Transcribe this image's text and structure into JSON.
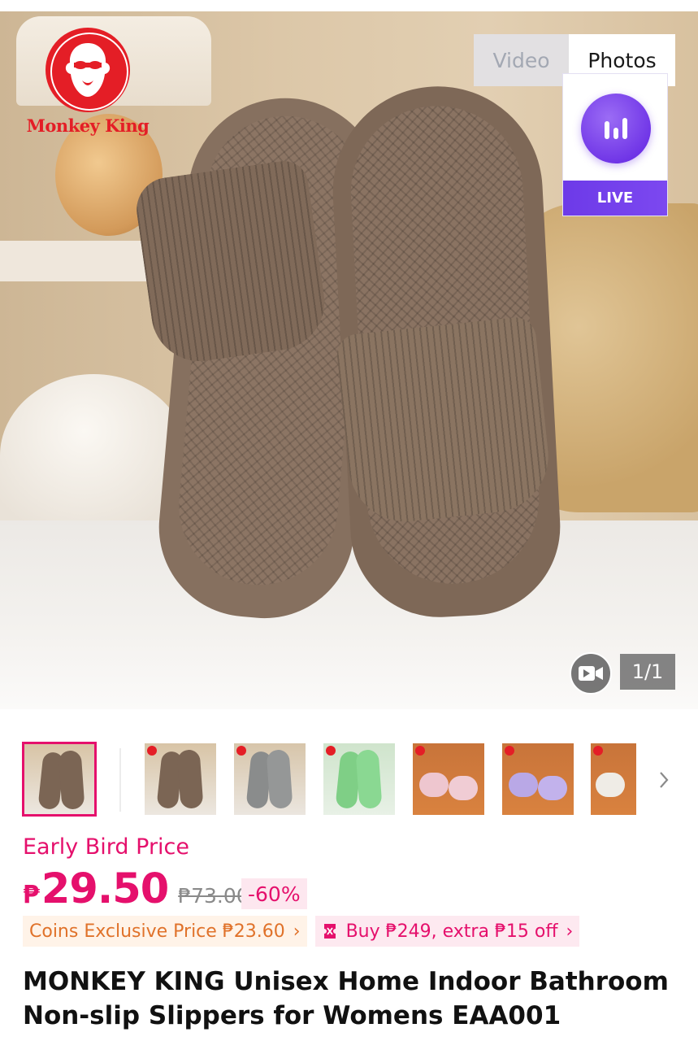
{
  "brand": {
    "logo_text": "Monkey King"
  },
  "media": {
    "tabs": [
      {
        "label": "Video",
        "active": false
      },
      {
        "label": "Photos",
        "active": true
      }
    ],
    "live_label": "LIVE",
    "counter": "1/1",
    "video_icon": "video-camera-icon"
  },
  "thumbnails": [
    {
      "color": "brown",
      "selected": true
    },
    {
      "color": "brown",
      "selected": false
    },
    {
      "color": "grey",
      "selected": false
    },
    {
      "color": "green",
      "selected": false
    },
    {
      "color": "pink",
      "selected": false
    },
    {
      "color": "purple",
      "selected": false
    },
    {
      "color": "white",
      "selected": false
    }
  ],
  "price": {
    "promo_label": "Early Bird Price",
    "currency": "₱",
    "current": "29.50",
    "original": "₱73.00",
    "discount": "-60%"
  },
  "chips": {
    "coins": "Coins Exclusive Price ₱23.60",
    "deal": "Buy ₱249, extra ₱15 off"
  },
  "product": {
    "title": "MONKEY KING Unisex Home Indoor Bathroom Non-slip Slippers for Womens EAA001"
  },
  "colors": {
    "accent": "#e5106c",
    "live": "#6d3ae8",
    "coins": "#e0722a"
  }
}
